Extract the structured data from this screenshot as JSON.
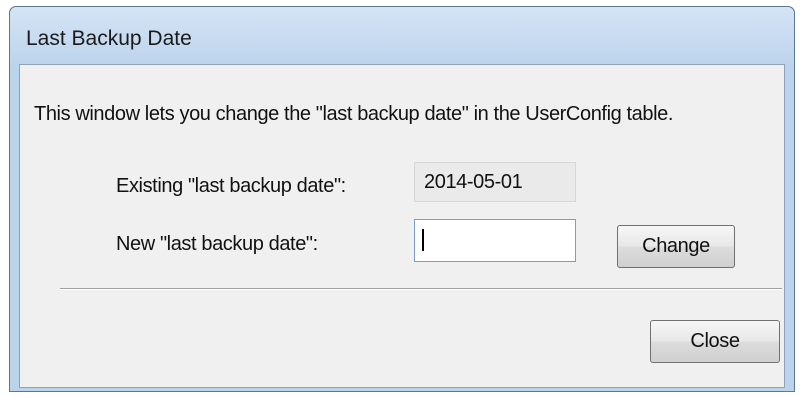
{
  "window": {
    "title": "Last Backup Date"
  },
  "dialog": {
    "description": "This window lets you change the \"last backup date\" in the UserConfig table.",
    "existing_label": "Existing \"last backup date\":",
    "existing_value": "2014-05-01",
    "new_label": "New \"last backup date\":",
    "new_value": "",
    "change_label": "Change",
    "close_label": "Close"
  }
}
